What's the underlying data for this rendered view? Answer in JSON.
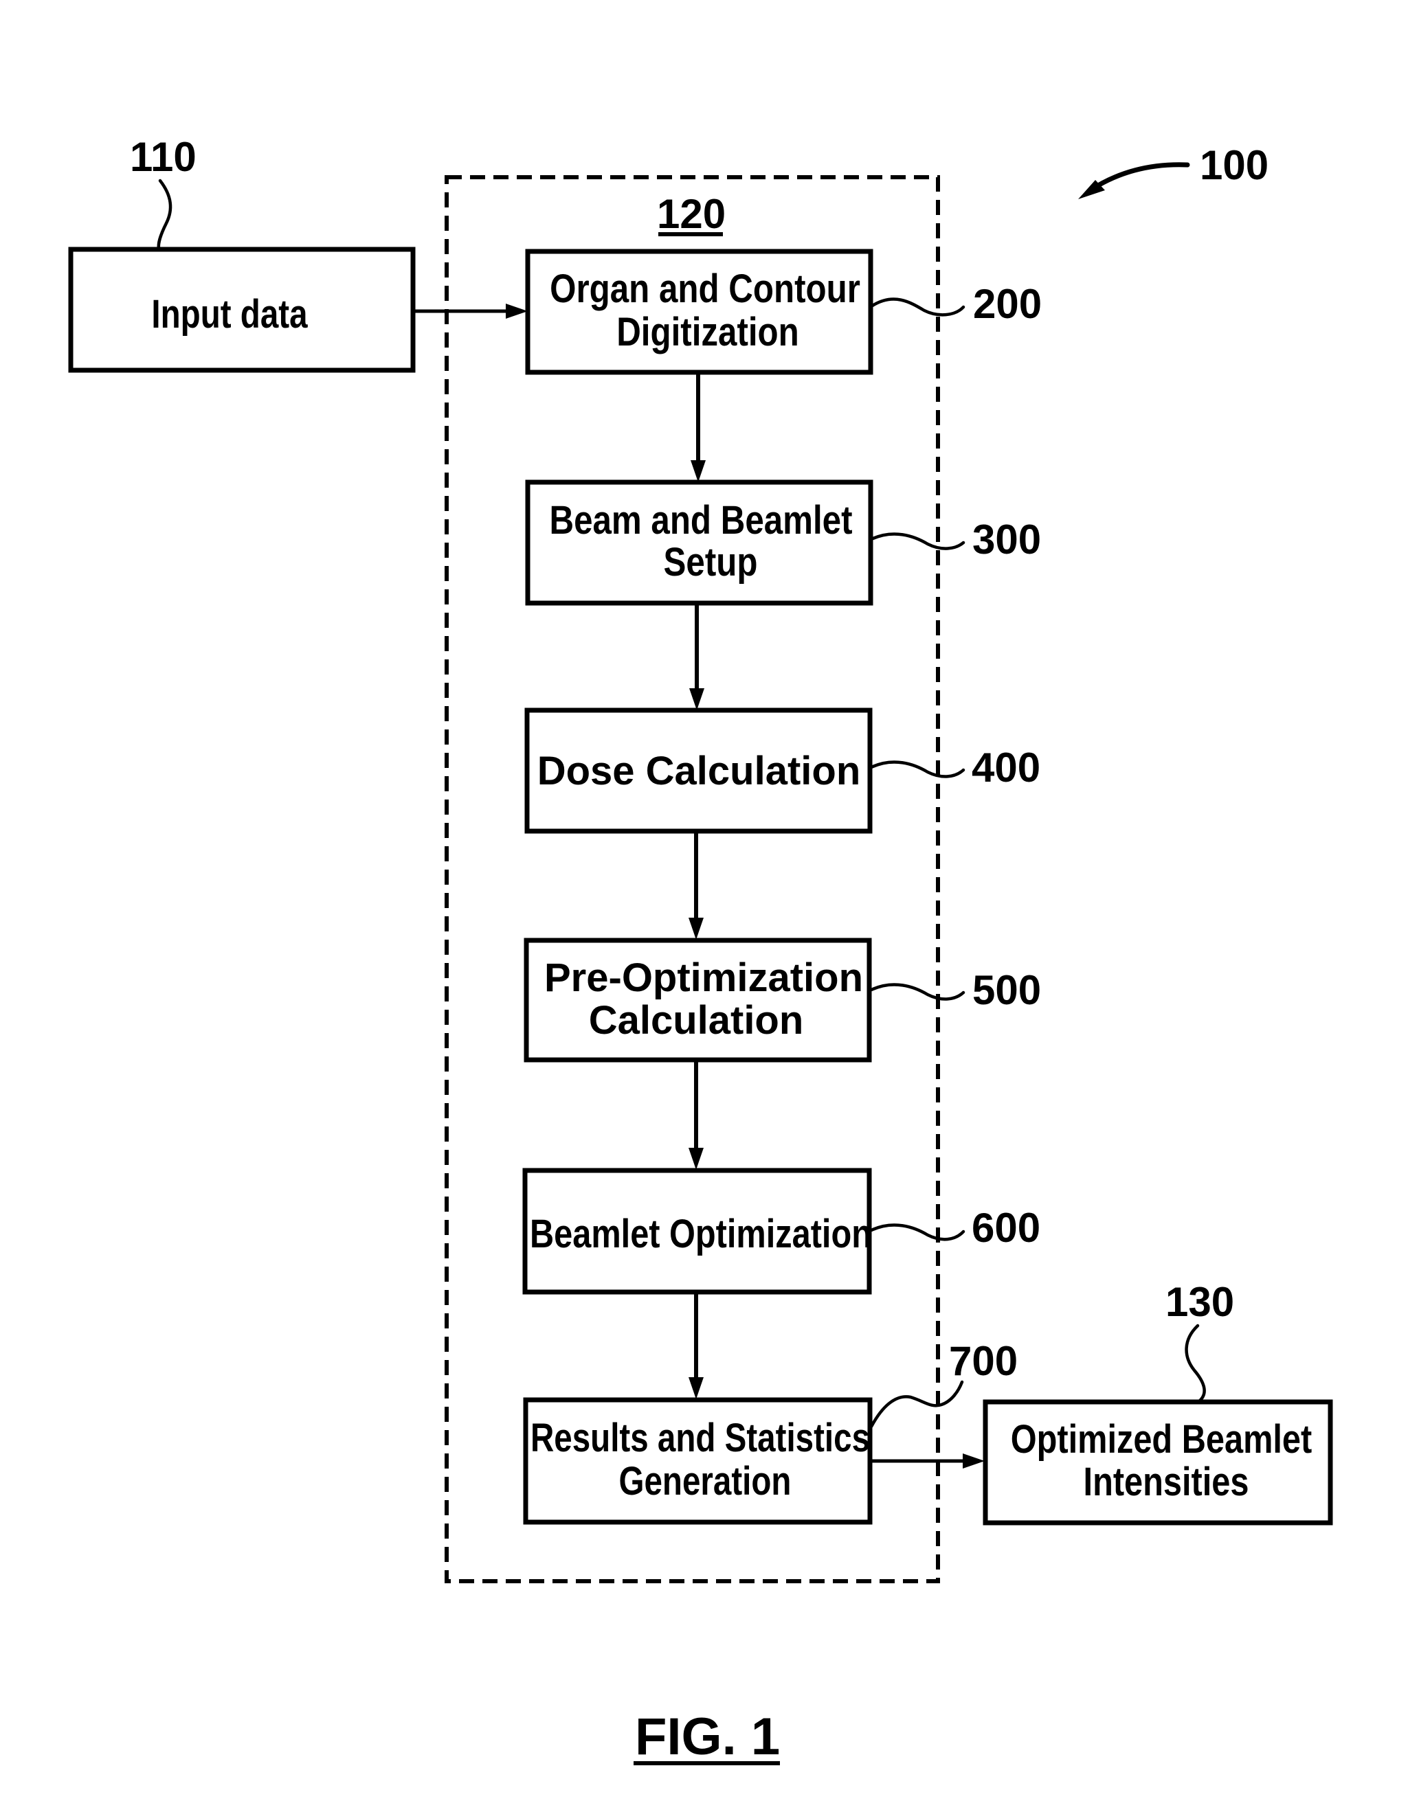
{
  "figure": {
    "caption": "FIG. 1",
    "system_ref": "100",
    "process_ref": "120"
  },
  "input": {
    "ref": "110",
    "label": "Input data"
  },
  "steps": [
    {
      "ref": "200",
      "lines": [
        "Organ and Contour",
        "Digitization"
      ]
    },
    {
      "ref": "300",
      "lines": [
        "Beam and Beamlet",
        "Setup"
      ]
    },
    {
      "ref": "400",
      "lines": [
        "Dose Calculation"
      ]
    },
    {
      "ref": "500",
      "lines": [
        "Pre-Optimization",
        "Calculation"
      ]
    },
    {
      "ref": "600",
      "lines": [
        "Beamlet Optimization"
      ]
    },
    {
      "ref": "700",
      "lines": [
        "Results and Statistics",
        "Generation"
      ]
    }
  ],
  "output": {
    "ref": "130",
    "lines": [
      "Optimized Beamlet",
      "Intensities"
    ]
  },
  "colors": {
    "ink": "#000000",
    "paper": "#ffffff"
  }
}
